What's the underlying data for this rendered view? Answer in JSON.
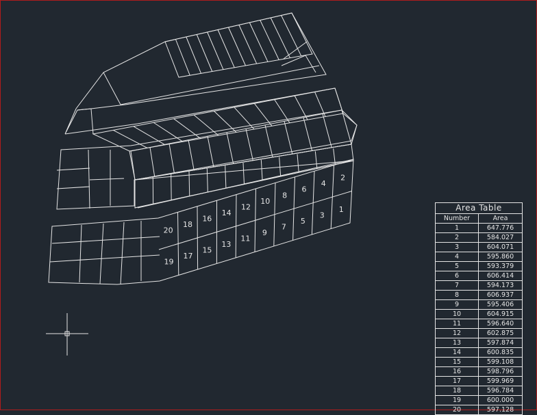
{
  "area_table": {
    "title": "Area Table",
    "headers": {
      "number": "Number",
      "area": "Area"
    },
    "rows": [
      {
        "number": "1",
        "area": "647.776"
      },
      {
        "number": "2",
        "area": "584.027"
      },
      {
        "number": "3",
        "area": "604.071"
      },
      {
        "number": "4",
        "area": "595.860"
      },
      {
        "number": "5",
        "area": "593.379"
      },
      {
        "number": "6",
        "area": "606.414"
      },
      {
        "number": "7",
        "area": "594.173"
      },
      {
        "number": "8",
        "area": "606.937"
      },
      {
        "number": "9",
        "area": "595.406"
      },
      {
        "number": "10",
        "area": "604.915"
      },
      {
        "number": "11",
        "area": "596.640"
      },
      {
        "number": "12",
        "area": "602.875"
      },
      {
        "number": "13",
        "area": "597.874"
      },
      {
        "number": "14",
        "area": "600.835"
      },
      {
        "number": "15",
        "area": "599.108"
      },
      {
        "number": "16",
        "area": "598.796"
      },
      {
        "number": "17",
        "area": "599.969"
      },
      {
        "number": "18",
        "area": "596.784"
      },
      {
        "number": "19",
        "area": "600.000"
      },
      {
        "number": "20",
        "area": "597.128"
      }
    ]
  },
  "lot_labels": [
    "1",
    "2",
    "3",
    "4",
    "5",
    "6",
    "7",
    "8",
    "9",
    "10",
    "11",
    "12",
    "13",
    "14",
    "15",
    "16",
    "17",
    "18",
    "19",
    "20"
  ],
  "colors": {
    "background": "#212830",
    "linework": "#e6e6e6",
    "frame": "#b01c1c"
  },
  "cursor_icon": "crosshair-icon"
}
